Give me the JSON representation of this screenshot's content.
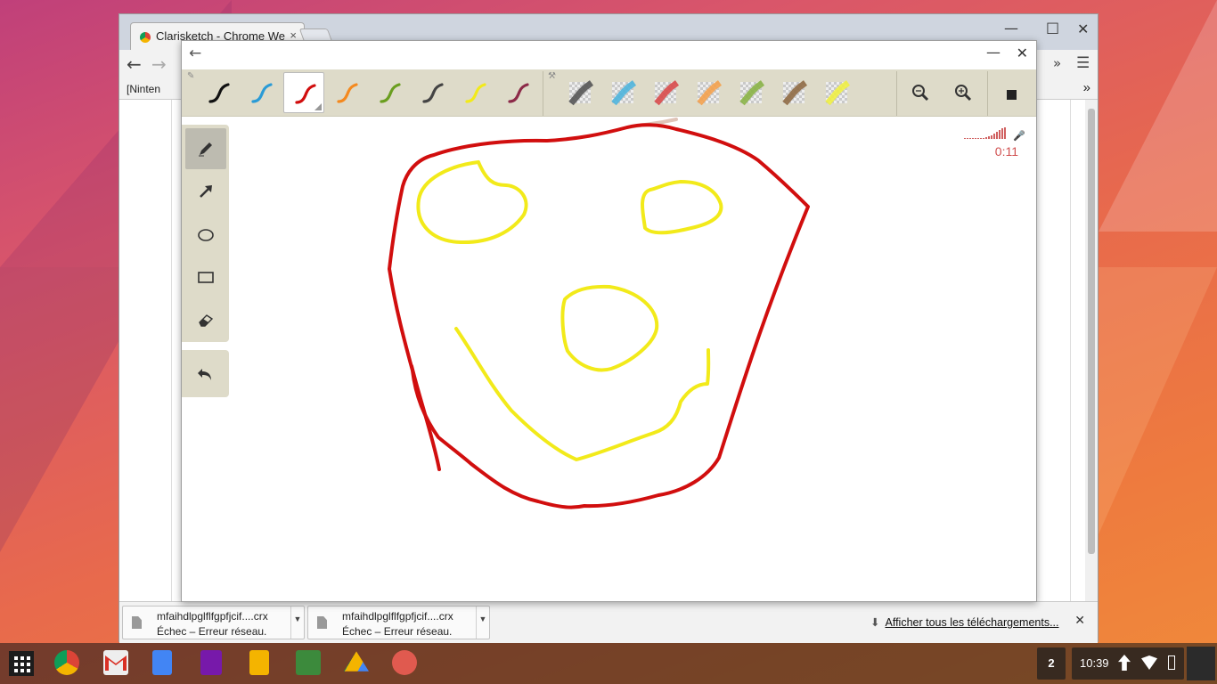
{
  "browser": {
    "tab_title": "Clarisketch - Chrome We",
    "tab_close": "×",
    "minimize": "—",
    "maximize": "□",
    "close": "✕",
    "back": "←",
    "forward": "→",
    "overflow": "»",
    "menu": "☰",
    "bookmark": "[Ninten",
    "bookmarks_overflow": "»"
  },
  "app": {
    "back": "←",
    "minimize": "—",
    "close": "✕",
    "pens": [
      {
        "name": "black",
        "color": "#111111"
      },
      {
        "name": "blue",
        "color": "#2a9bd6"
      },
      {
        "name": "red",
        "color": "#d10e0e",
        "selected": true
      },
      {
        "name": "orange",
        "color": "#f4891e"
      },
      {
        "name": "green",
        "color": "#6a9e1f"
      },
      {
        "name": "dark-gray",
        "color": "#444444"
      },
      {
        "name": "yellow",
        "color": "#f2ea1a"
      },
      {
        "name": "maroon",
        "color": "#8c2a48"
      }
    ],
    "highlighters": [
      {
        "name": "gray",
        "color": "#555555"
      },
      {
        "name": "blue",
        "color": "#4fb4dc"
      },
      {
        "name": "red",
        "color": "#d84a4a"
      },
      {
        "name": "orange",
        "color": "#f3a14e"
      },
      {
        "name": "green",
        "color": "#8ab347"
      },
      {
        "name": "brown",
        "color": "#8f6a44"
      },
      {
        "name": "yellow",
        "color": "#eeee44"
      }
    ],
    "tools": [
      "pen-tool",
      "arrow-tool",
      "ellipse-tool",
      "rectangle-tool",
      "eraser-tool"
    ],
    "recording_time": "0:11"
  },
  "drawing": {
    "face_color": "#d10e0e",
    "features_color": "#f2ea1a"
  },
  "downloads": {
    "items": [
      {
        "filename": "mfaihdlpglflfgpfjcif....crx",
        "status": "Échec – Erreur réseau."
      },
      {
        "filename": "mfaihdlpglflfgpfjcif....crx",
        "status": "Échec – Erreur réseau."
      }
    ],
    "show_all": "Afficher tous les téléchargements...",
    "close": "✕"
  },
  "shelf": {
    "notification_count": "2",
    "time": "10:39"
  }
}
